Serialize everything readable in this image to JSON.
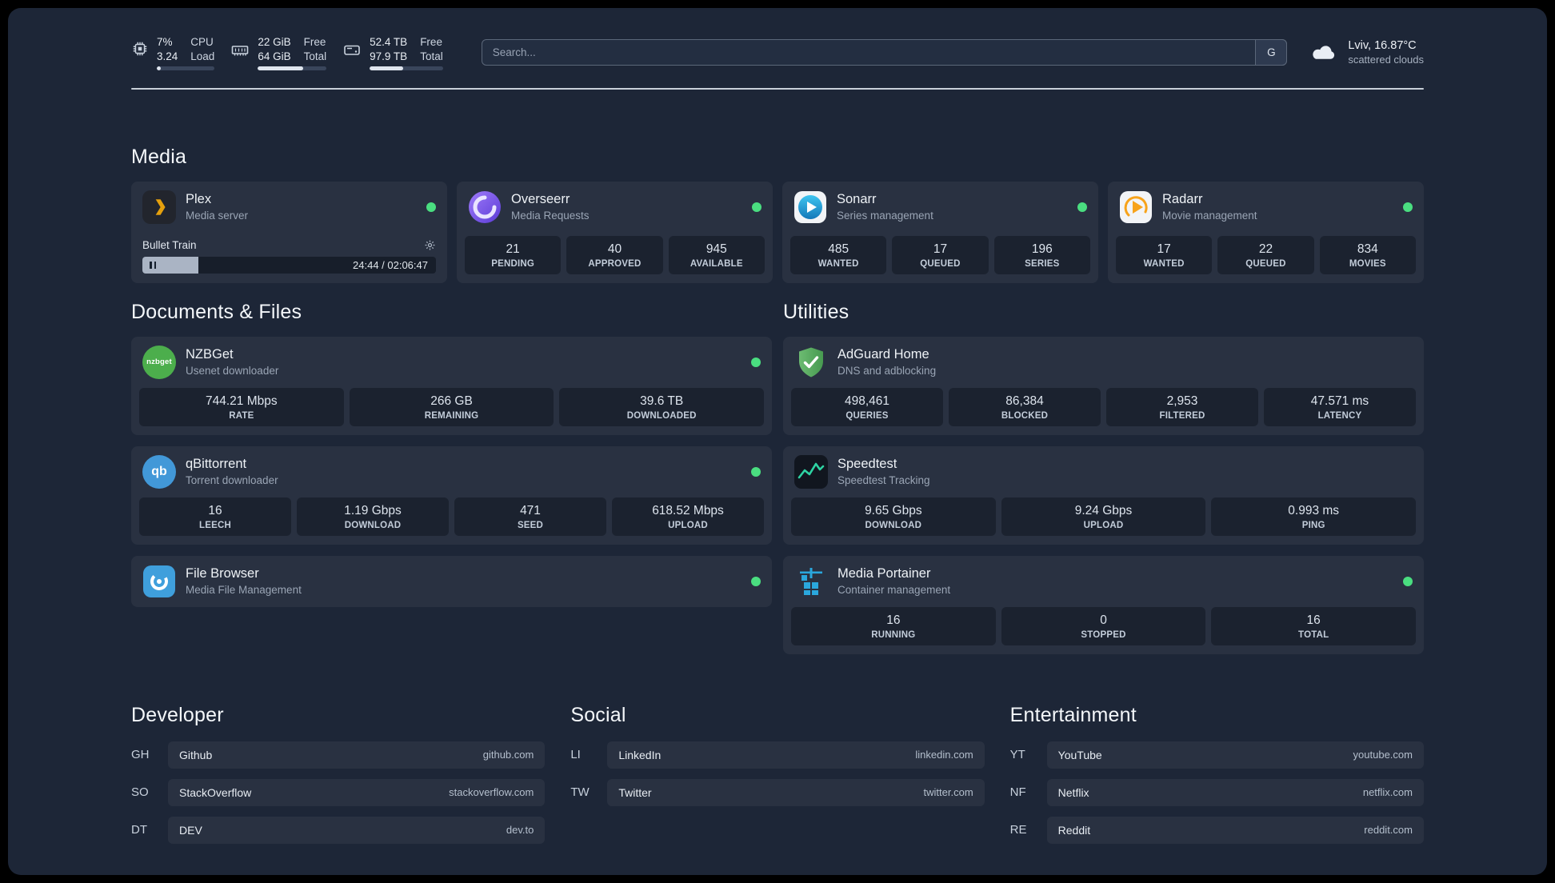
{
  "colors": {
    "status-online": "#4ade80",
    "bar-fill": "#dfe5ee",
    "divider": "#dbe2ea"
  },
  "topbar": {
    "cpu": {
      "value1": "7%",
      "label1": "CPU",
      "value2": "3.24",
      "label2": "Load",
      "progress": 7
    },
    "memory": {
      "value1": "22 GiB",
      "label1": "Free",
      "value2": "64 GiB",
      "label2": "Total",
      "progress": 66
    },
    "disk": {
      "value1": "52.4 TB",
      "label1": "Free",
      "value2": "97.9 TB",
      "label2": "Total",
      "progress": 46
    },
    "search": {
      "placeholder": "Search...",
      "button_label": "G"
    },
    "weather": {
      "location": "Lviv, 16.87°C",
      "condition": "scattered clouds"
    }
  },
  "media": {
    "heading": "Media",
    "plex": {
      "title": "Plex",
      "subtitle": "Media server",
      "now_playing": "Bullet Train",
      "time": "24:44 / 02:06:47",
      "progress": 19
    },
    "overseerr": {
      "title": "Overseerr",
      "subtitle": "Media Requests",
      "stats": [
        {
          "value": "21",
          "label": "PENDING"
        },
        {
          "value": "40",
          "label": "APPROVED"
        },
        {
          "value": "945",
          "label": "AVAILABLE"
        }
      ]
    },
    "sonarr": {
      "title": "Sonarr",
      "subtitle": "Series management",
      "stats": [
        {
          "value": "485",
          "label": "WANTED"
        },
        {
          "value": "17",
          "label": "QUEUED"
        },
        {
          "value": "196",
          "label": "SERIES"
        }
      ]
    },
    "radarr": {
      "title": "Radarr",
      "subtitle": "Movie management",
      "stats": [
        {
          "value": "17",
          "label": "WANTED"
        },
        {
          "value": "22",
          "label": "QUEUED"
        },
        {
          "value": "834",
          "label": "MOVIES"
        }
      ]
    }
  },
  "documents": {
    "heading": "Documents & Files",
    "nzbget": {
      "title": "NZBGet",
      "subtitle": "Usenet downloader",
      "icon_text": "nzbget",
      "stats": [
        {
          "value": "744.21 Mbps",
          "label": "RATE"
        },
        {
          "value": "266 GB",
          "label": "REMAINING"
        },
        {
          "value": "39.6 TB",
          "label": "DOWNLOADED"
        }
      ]
    },
    "qbittorrent": {
      "title": "qBittorrent",
      "subtitle": "Torrent downloader",
      "icon_text": "qb",
      "stats": [
        {
          "value": "16",
          "label": "LEECH"
        },
        {
          "value": "1.19 Gbps",
          "label": "DOWNLOAD"
        },
        {
          "value": "471",
          "label": "SEED"
        },
        {
          "value": "618.52 Mbps",
          "label": "UPLOAD"
        }
      ]
    },
    "filebrowser": {
      "title": "File Browser",
      "subtitle": "Media File Management"
    }
  },
  "utilities": {
    "heading": "Utilities",
    "adguard": {
      "title": "AdGuard Home",
      "subtitle": "DNS and adblocking",
      "stats": [
        {
          "value": "498,461",
          "label": "QUERIES"
        },
        {
          "value": "86,384",
          "label": "BLOCKED"
        },
        {
          "value": "2,953",
          "label": "FILTERED"
        },
        {
          "value": "47.571 ms",
          "label": "LATENCY"
        }
      ]
    },
    "speedtest": {
      "title": "Speedtest",
      "subtitle": "Speedtest Tracking",
      "stats": [
        {
          "value": "9.65 Gbps",
          "label": "DOWNLOAD"
        },
        {
          "value": "9.24 Gbps",
          "label": "UPLOAD"
        },
        {
          "value": "0.993 ms",
          "label": "PING"
        }
      ]
    },
    "portainer": {
      "title": "Media Portainer",
      "subtitle": "Container management",
      "stats": [
        {
          "value": "16",
          "label": "RUNNING"
        },
        {
          "value": "0",
          "label": "STOPPED"
        },
        {
          "value": "16",
          "label": "TOTAL"
        }
      ]
    }
  },
  "bookmarks": {
    "developer": {
      "heading": "Developer",
      "items": [
        {
          "abbr": "GH",
          "name": "Github",
          "url": "github.com"
        },
        {
          "abbr": "SO",
          "name": "StackOverflow",
          "url": "stackoverflow.com"
        },
        {
          "abbr": "DT",
          "name": "DEV",
          "url": "dev.to"
        }
      ]
    },
    "social": {
      "heading": "Social",
      "items": [
        {
          "abbr": "LI",
          "name": "LinkedIn",
          "url": "linkedin.com"
        },
        {
          "abbr": "TW",
          "name": "Twitter",
          "url": "twitter.com"
        }
      ]
    },
    "entertainment": {
      "heading": "Entertainment",
      "items": [
        {
          "abbr": "YT",
          "name": "YouTube",
          "url": "youtube.com"
        },
        {
          "abbr": "NF",
          "name": "Netflix",
          "url": "netflix.com"
        },
        {
          "abbr": "RE",
          "name": "Reddit",
          "url": "reddit.com"
        }
      ]
    }
  }
}
